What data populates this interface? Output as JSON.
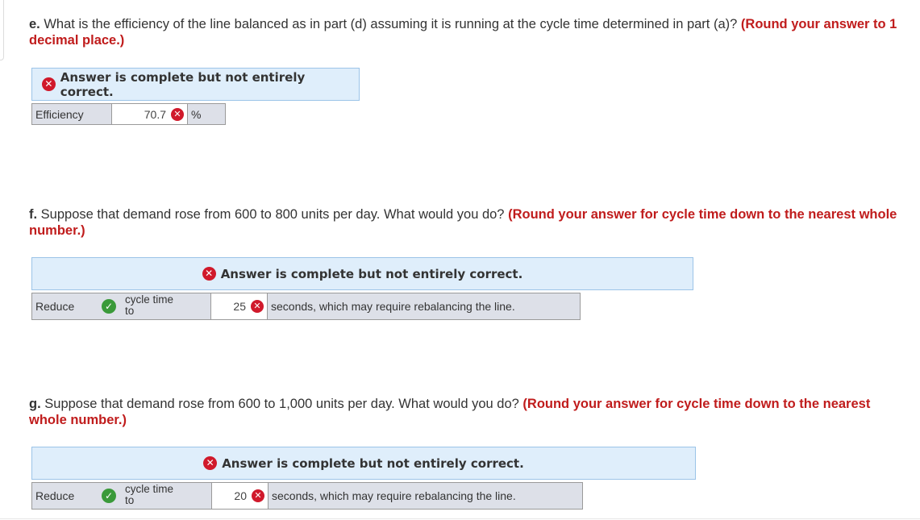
{
  "colors": {
    "hint": "#c01c1c",
    "banner_bg": "#dfeefb",
    "banner_border": "#9cc4e8",
    "wrong": "#d0192b",
    "correct": "#3a9a3a",
    "row_gray": "#dde0e8"
  },
  "icons": {
    "wrong": "close-circle-icon",
    "correct": "check-circle-icon"
  },
  "part_e": {
    "letter": "e.",
    "question": " What is the efficiency of the line balanced as in part (d) assuming it is running at the cycle time determined in part (a)? ",
    "hint": "(Round your answer to 1 decimal place.)",
    "banner": "Answer is complete but not entirely correct.",
    "label": "Efficiency",
    "value": "70.7",
    "unit": "%"
  },
  "part_f": {
    "letter": "f.",
    "question": " Suppose that demand rose from 600 to 800 units per day. What would you do? ",
    "hint": "(Round your answer for cycle time down to the nearest whole number.)",
    "banner": "Answer is complete but not entirely correct.",
    "action": "Reduce",
    "target_line1": "cycle time",
    "target_line2": "to",
    "value": "25",
    "suffix": "seconds, which may require rebalancing the line."
  },
  "part_g": {
    "letter": "g.",
    "question": " Suppose that demand rose from 600 to 1,000 units per day. What would you do? ",
    "hint": "(Round your answer for cycle time down to the nearest whole number.)",
    "banner": "Answer is complete but not entirely correct.",
    "action": "Reduce",
    "target_line1": "cycle time",
    "target_line2": "to",
    "value": "20",
    "suffix": "seconds, which may require rebalancing the line."
  }
}
